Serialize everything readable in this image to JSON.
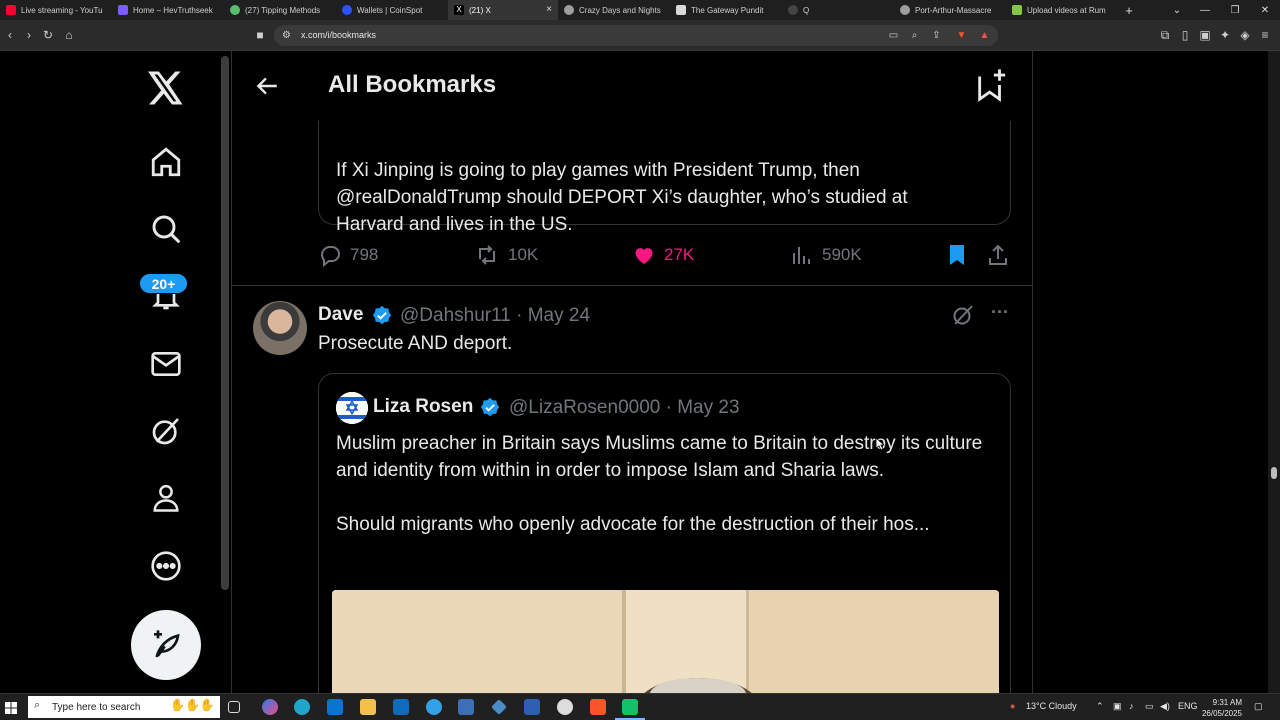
{
  "browser": {
    "tabs": [
      {
        "label": "Live streaming - YouTu",
        "color": "#ff0033"
      },
      {
        "label": "Home – HevTruthseek",
        "color": "#7b5cff"
      },
      {
        "label": "(27) Tipping Methods",
        "color": "#58c06d"
      },
      {
        "label": "Wallets | CoinSpot",
        "color": "#2c52ff"
      },
      {
        "label": "(21) X",
        "color": "#000000"
      },
      {
        "label": "Crazy Days and Nights",
        "color": "#9e9e9e"
      },
      {
        "label": "The Gateway Pundit",
        "color": "#d9d9d9"
      },
      {
        "label": "Q",
        "color": "#444444"
      },
      {
        "label": "Port-Arthur-Massacre",
        "color": "#9e9e9e"
      },
      {
        "label": "Upload videos at Rum",
        "color": "#85c742"
      }
    ],
    "active_tab_close": "×",
    "new_tab": "+",
    "url": "x.com/i/bookmarks"
  },
  "sidebar": {
    "notifications_badge": "20+"
  },
  "header": {
    "title": "All Bookmarks"
  },
  "tweet1": {
    "quote_text": "If Xi Jinping is going to play games with President Trump, then\n@realDonaldTrump should DEPORT Xi’s daughter, who’s studied at\nHarvard and lives in the US.",
    "replies": "798",
    "reposts": "10K",
    "likes": "27K",
    "views": "590K"
  },
  "tweet2": {
    "name": "Dave",
    "handle": "@Dahshur11 · May 24",
    "text": "Prosecute AND deport.",
    "quote": {
      "name": "Liza Rosen",
      "handle": "@LizaRosen0000 · May 23",
      "para1": "Muslim preacher in Britain says Muslims came to Britain to destroy its culture and identity from within in order to impose Islam and Sharia laws.",
      "para2": "Should migrants who openly advocate for the destruction of their hos..."
    }
  },
  "taskbar": {
    "search_placeholder": "Type here to search",
    "weather": "13°C  Cloudy",
    "lang": "ENG",
    "time": "9:31 AM",
    "date": "26/05/2025"
  },
  "colors": {
    "accent": "#1d9bf0",
    "like": "#f91880"
  }
}
